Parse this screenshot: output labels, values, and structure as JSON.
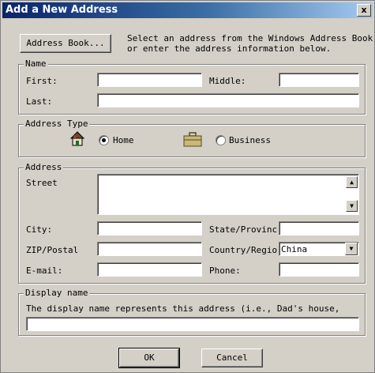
{
  "window": {
    "title": "Add a New Address",
    "close_glyph": "x"
  },
  "address_book": {
    "button_label": "Address Book...",
    "hint": "Select an address from the Windows Address Book\nor enter the address information below."
  },
  "name_group": {
    "label": "Name",
    "first_label": "First:",
    "middle_label": "Middle:",
    "last_label": "Last:",
    "first_value": "",
    "middle_value": "",
    "last_value": ""
  },
  "address_type": {
    "label": "Address Type",
    "home_label": "Home",
    "business_label": "Business",
    "selected": "Home"
  },
  "address_group": {
    "label": "Address",
    "street_label": "Street",
    "city_label": "City:",
    "state_label": "State/Provinc",
    "zip_label": "ZIP/Postal",
    "country_label": "Country/Regio",
    "country_value": "China",
    "email_label": "E-mail:",
    "phone_label": "Phone:"
  },
  "display_name": {
    "label": "Display name",
    "hint": "The display name represents this address (i.e., Dad's house,",
    "value": ""
  },
  "buttons": {
    "ok": "OK",
    "cancel": "Cancel"
  },
  "icons": {
    "home": "house-icon",
    "business": "briefcase-icon"
  }
}
